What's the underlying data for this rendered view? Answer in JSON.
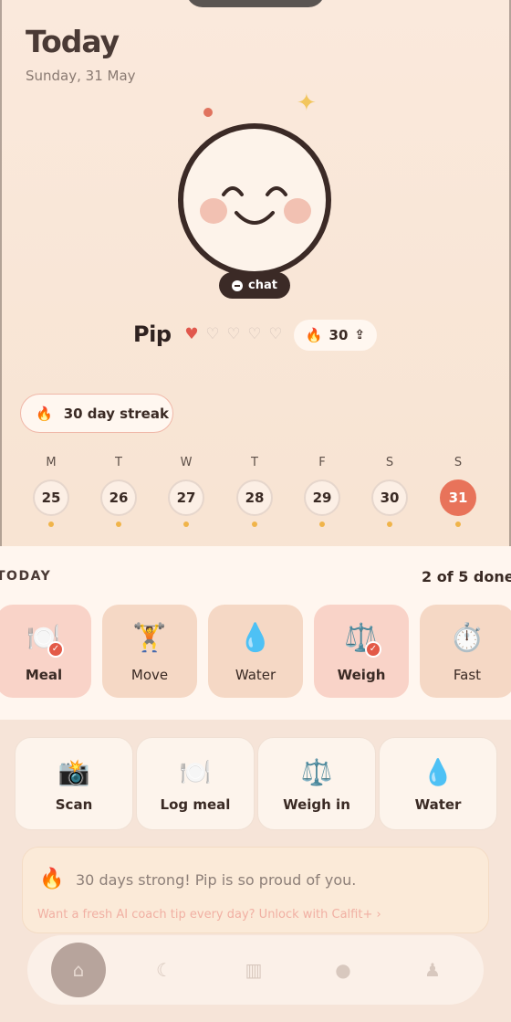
{
  "header": {
    "title": "Today",
    "date": "Sunday, 31 May"
  },
  "pet": {
    "name": "Pip",
    "chat_label": "chat",
    "hearts_full": 1,
    "hearts_total": 5
  },
  "flame_badge": {
    "count": "30"
  },
  "streak": {
    "label": "30 day streak"
  },
  "week": [
    {
      "letter": "M",
      "num": "25",
      "active": false
    },
    {
      "letter": "T",
      "num": "26",
      "active": false
    },
    {
      "letter": "W",
      "num": "27",
      "active": false
    },
    {
      "letter": "T",
      "num": "28",
      "active": false
    },
    {
      "letter": "F",
      "num": "29",
      "active": false
    },
    {
      "letter": "S",
      "num": "30",
      "active": false
    },
    {
      "letter": "S",
      "num": "31",
      "active": true
    }
  ],
  "today_panel": {
    "title": "TODAY",
    "count": "2 of 5 done",
    "habits": [
      {
        "label": "Meal",
        "icon": "plate-icon",
        "done": true
      },
      {
        "label": "Move",
        "icon": "trophy-icon",
        "done": false
      },
      {
        "label": "Water",
        "icon": "droplet-icon",
        "done": false
      },
      {
        "label": "Weigh",
        "icon": "scale-icon",
        "done": true
      },
      {
        "label": "Fast",
        "icon": "stopwatch-icon",
        "done": false
      }
    ]
  },
  "actions": [
    {
      "label": "Scan",
      "icon": "camera-icon"
    },
    {
      "label": "Log meal",
      "icon": "plate-icon"
    },
    {
      "label": "Weigh in",
      "icon": "scale-icon"
    },
    {
      "label": "Water",
      "icon": "droplet-icon"
    }
  ],
  "message": {
    "text": "30 days strong! Pip is so proud of you.",
    "cta": "Want a fresh AI coach tip every day? Unlock with Calfit+ ›"
  },
  "tabs": [
    {
      "name": "home",
      "icon": "home-icon"
    },
    {
      "name": "sleep",
      "icon": "moon-icon"
    },
    {
      "name": "stats",
      "icon": "chart-icon"
    },
    {
      "name": "pet",
      "icon": "pet-icon"
    },
    {
      "name": "profile",
      "icon": "user-icon"
    }
  ],
  "colors": {
    "accent": "#e8735a",
    "dark": "#3b2a26",
    "background": "#f8e6d6"
  }
}
